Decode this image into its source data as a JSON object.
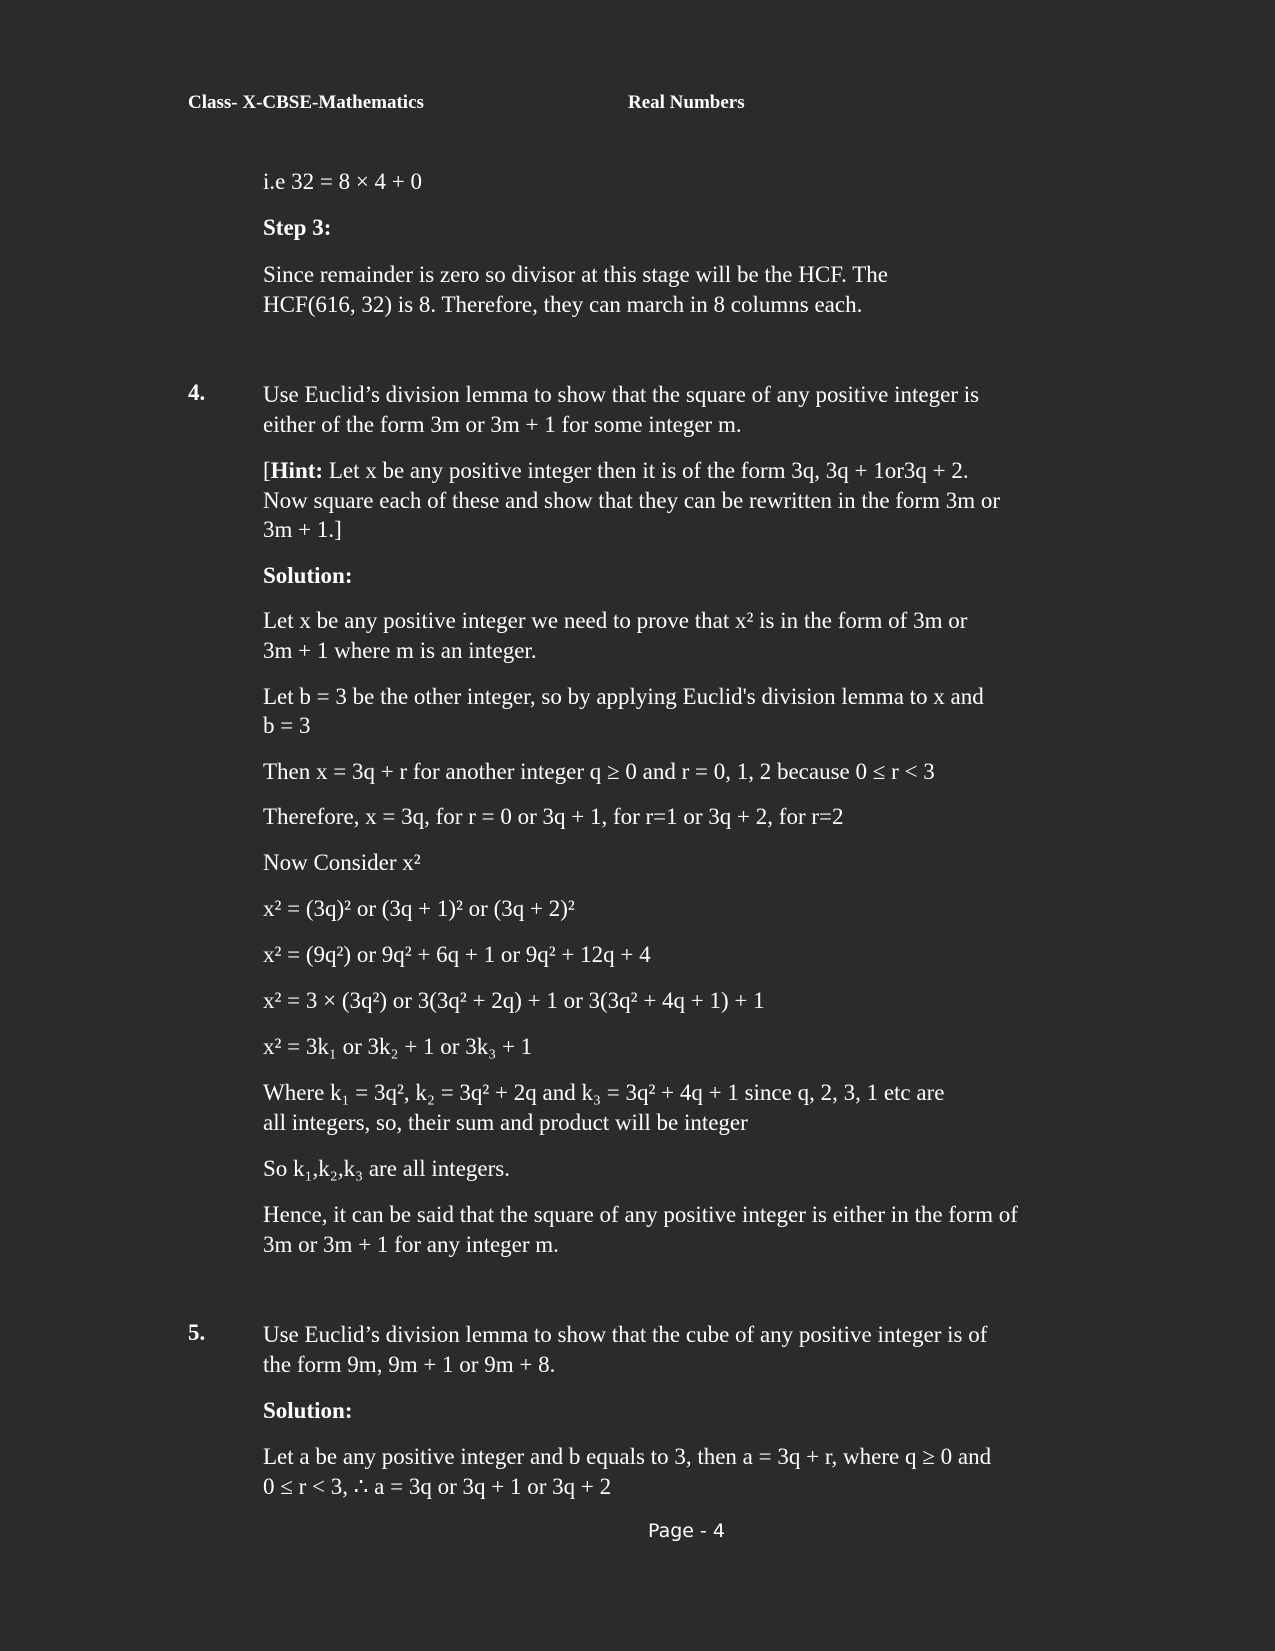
{
  "header": {
    "left": "Class- X-CBSE-Mathematics",
    "right": "Real Numbers"
  },
  "blocks": {
    "b1": "i.e 32 = 8 × 4 + 0",
    "b2": "Step 3:",
    "b3a": "Since remainder is zero so divisor at this stage will be the HCF. The",
    "b3b": "HCF(616, 32) is 8. Therefore, they can march in 8 columns each.",
    "q4num": "4.",
    "q4a": "Use Euclid’s division lemma to show that the square of any positive integer is",
    "q4b": "either of the form 3m or 3m + 1 for some integer m.",
    "hint_label": "Hint:",
    "hint_a": "Let x be any positive integer then it is of the form 3q, 3q + 1or3q + 2.",
    "hint_b": "Now square each of these and show that they can be rewritten in the form 3m or",
    "hint_c": "3m + 1.]",
    "sol4": "Solution:",
    "s1a": "Let x be any positive integer we need to prove that x² is in the form of 3m or",
    "s1b": "3m + 1 where m is an integer.",
    "s2a": "Let b = 3 be the other integer, so by applying Euclid's division lemma to x and",
    "s2b": "b = 3",
    "s3": "Then x = 3q + r for another integer q ≥ 0 and r = 0, 1, 2 because 0 ≤ r < 3",
    "s4": "Therefore, x = 3q, for r = 0 or 3q + 1, for r=1 or 3q + 2, for r=2",
    "s5": "Now Consider x²",
    "s6": "x² = (3q)² or (3q + 1)² or (3q + 2)²",
    "s7": "x² = (9q²) or 9q² + 6q + 1 or 9q² + 12q + 4",
    "s8": "x² = 3 × (3q²) or 3(3q² + 2q) + 1 or 3(3q² + 4q + 1) + 1",
    "s9": "x² = 3k₁ or 3k₂ + 1 or 3k₃ + 1",
    "s10a": "Where k₁ = 3q², k₂ = 3q² + 2q and k₃ = 3q² + 4q + 1  since q, 2, 3, 1 etc are",
    "s10b": "all integers, so, their sum and product will be integer",
    "s11": "So k₁,k₂,k₃ are all integers.",
    "s12a": "Hence, it can be said that the square of any positive integer is either in the form of",
    "s12b": "3m or 3m + 1 for any integer m.",
    "q5num": "5.",
    "q5a": "Use Euclid’s division lemma to show that the cube of any positive integer is of",
    "q5b": "the form 9m, 9m + 1 or 9m + 8.",
    "sol5": "Solution:",
    "t1a": "Let a be any positive integer and b equals to 3, then a = 3q + r, where q ≥ 0 and",
    "t1b": "0 ≤ r < 3,  ∴ a = 3q or 3q + 1 or 3q + 2"
  },
  "footer": "Page - 4"
}
